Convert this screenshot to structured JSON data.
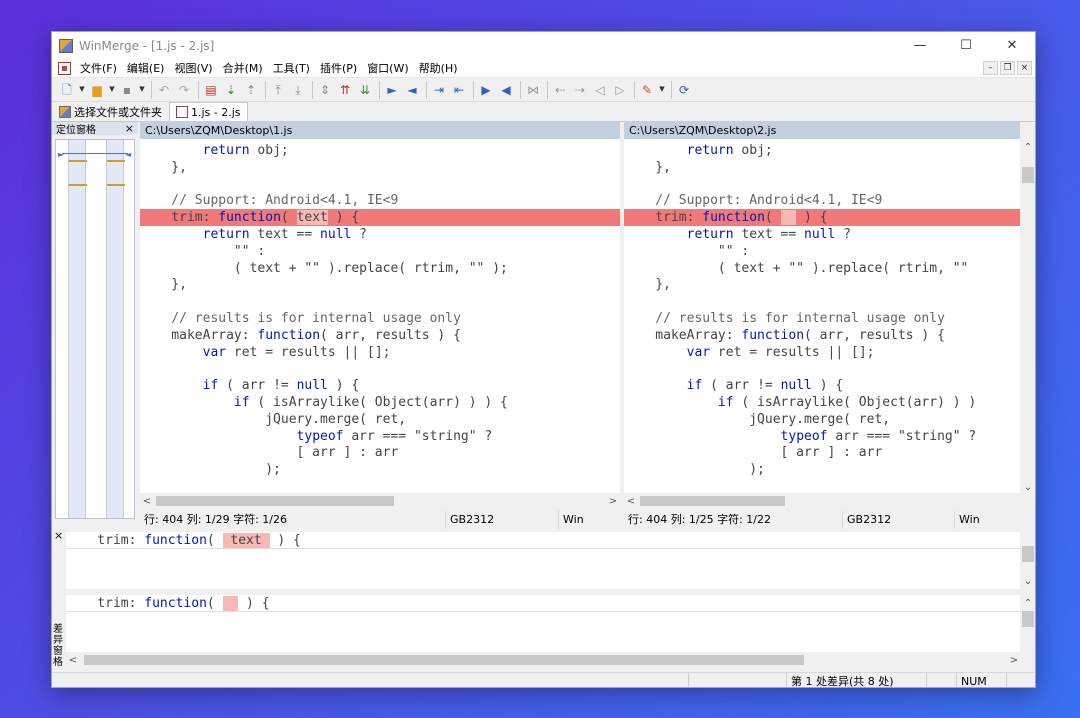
{
  "window": {
    "title": "WinMerge - [1.js - 2.js]",
    "min": "—",
    "max": "☐",
    "close": "✕"
  },
  "menu": {
    "items": [
      "文件(F)",
      "编辑(E)",
      "视图(V)",
      "合并(M)",
      "工具(T)",
      "插件(P)",
      "窗口(W)",
      "帮助(H)"
    ],
    "mdi_min": "–",
    "mdi_restore": "❐",
    "mdi_close": "×"
  },
  "tabs": {
    "open": "选择文件或文件夹",
    "compare": "1.js - 2.js"
  },
  "location_pane": {
    "title": "定位窗格",
    "close": "×",
    "left_arrow": "►",
    "right_arrow": "◄"
  },
  "left": {
    "path": "C:\\Users\\ZQM\\Desktop\\1.js",
    "status": {
      "pos": "行: 404  列: 1/29  字符: 1/26",
      "enc": "GB2312",
      "eol": "Win"
    },
    "lines": [
      [
        {
          "t": "        "
        },
        {
          "t": "return",
          "c": "kw"
        },
        {
          "t": " obj;"
        }
      ],
      [
        {
          "t": "    },"
        }
      ],
      [
        {
          "t": ""
        }
      ],
      [
        {
          "t": "    // Support: Android<4.1, IE<9",
          "c": "cm"
        }
      ],
      [
        {
          "t": "    trim: "
        },
        {
          "t": "function",
          "c": "kw"
        },
        {
          "t": "( "
        },
        {
          "t": "text",
          "c": "hl"
        },
        {
          "t": " ) {"
        }
      ],
      [
        {
          "t": "        "
        },
        {
          "t": "return",
          "c": "kw"
        },
        {
          "t": " text == "
        },
        {
          "t": "null",
          "c": "kw"
        },
        {
          "t": " ?"
        }
      ],
      [
        {
          "t": "            \"\" :"
        }
      ],
      [
        {
          "t": "            ( text + \"\" ).replace( rtrim, \"\" );"
        }
      ],
      [
        {
          "t": "    },"
        }
      ],
      [
        {
          "t": ""
        }
      ],
      [
        {
          "t": "    // results is for internal usage only",
          "c": "cm"
        }
      ],
      [
        {
          "t": "    makeArray: "
        },
        {
          "t": "function",
          "c": "kw"
        },
        {
          "t": "( arr, results ) {"
        }
      ],
      [
        {
          "t": "        "
        },
        {
          "t": "var",
          "c": "kw"
        },
        {
          "t": " ret = results || [];"
        }
      ],
      [
        {
          "t": ""
        }
      ],
      [
        {
          "t": "        "
        },
        {
          "t": "if",
          "c": "kw"
        },
        {
          "t": " ( arr != "
        },
        {
          "t": "null",
          "c": "kw"
        },
        {
          "t": " ) {"
        }
      ],
      [
        {
          "t": "            "
        },
        {
          "t": "if",
          "c": "kw"
        },
        {
          "t": " ( isArraylike( Object(arr) ) ) {"
        }
      ],
      [
        {
          "t": "                jQuery.merge( ret,"
        }
      ],
      [
        {
          "t": "                    "
        },
        {
          "t": "typeof",
          "c": "kw"
        },
        {
          "t": " arr === \"string\" ?"
        }
      ],
      [
        {
          "t": "                    [ arr ] : arr"
        }
      ],
      [
        {
          "t": "                );"
        }
      ]
    ]
  },
  "right": {
    "path": "C:\\Users\\ZQM\\Desktop\\2.js",
    "status": {
      "pos": "行: 404  列: 1/25  字符: 1/22",
      "enc": "GB2312",
      "eol": "Win"
    },
    "lines": [
      [
        {
          "t": "        "
        },
        {
          "t": "return",
          "c": "kw"
        },
        {
          "t": " obj;"
        }
      ],
      [
        {
          "t": "    },"
        }
      ],
      [
        {
          "t": ""
        }
      ],
      [
        {
          "t": "    // Support: Android<4.1, IE<9",
          "c": "cm"
        }
      ],
      [
        {
          "t": "    trim: "
        },
        {
          "t": "function",
          "c": "kw"
        },
        {
          "t": "( "
        },
        {
          "t": "  ",
          "c": "hl"
        },
        {
          "t": " ) {"
        }
      ],
      [
        {
          "t": "        "
        },
        {
          "t": "return",
          "c": "kw"
        },
        {
          "t": " text == "
        },
        {
          "t": "null",
          "c": "kw"
        },
        {
          "t": " ?"
        }
      ],
      [
        {
          "t": "            \"\" :"
        }
      ],
      [
        {
          "t": "            ( text + \"\" ).replace( rtrim, \"\""
        }
      ],
      [
        {
          "t": "    },"
        }
      ],
      [
        {
          "t": ""
        }
      ],
      [
        {
          "t": "    // results is for internal usage only",
          "c": "cm"
        }
      ],
      [
        {
          "t": "    makeArray: "
        },
        {
          "t": "function",
          "c": "kw"
        },
        {
          "t": "( arr, results ) {"
        }
      ],
      [
        {
          "t": "        "
        },
        {
          "t": "var",
          "c": "kw"
        },
        {
          "t": " ret = results || [];"
        }
      ],
      [
        {
          "t": ""
        }
      ],
      [
        {
          "t": "        "
        },
        {
          "t": "if",
          "c": "kw"
        },
        {
          "t": " ( arr != "
        },
        {
          "t": "null",
          "c": "kw"
        },
        {
          "t": " ) {"
        }
      ],
      [
        {
          "t": "            "
        },
        {
          "t": "if",
          "c": "kw"
        },
        {
          "t": " ( isArraylike( Object(arr) ) )"
        }
      ],
      [
        {
          "t": "                jQuery.merge( ret,"
        }
      ],
      [
        {
          "t": "                    "
        },
        {
          "t": "typeof",
          "c": "kw"
        },
        {
          "t": " arr === \"string\" ?"
        }
      ],
      [
        {
          "t": "                    [ arr ] : arr"
        }
      ],
      [
        {
          "t": "                );"
        }
      ]
    ]
  },
  "diff_bar": {
    "label": "差异窗格",
    "close": "×",
    "left_line": [
      {
        "t": "    trim: "
      },
      {
        "t": "function",
        "c": "kw"
      },
      {
        "t": "( "
      },
      {
        "t": " text ",
        "c": "hl"
      },
      {
        "t": " ) {"
      }
    ],
    "right_line": [
      {
        "t": "    trim: "
      },
      {
        "t": "function",
        "c": "kw"
      },
      {
        "t": "( "
      },
      {
        "t": "  ",
        "c": "hl"
      },
      {
        "t": " ) {"
      }
    ]
  },
  "status": {
    "diff_info": "第 1 处差异(共 8 处)",
    "num": "NUM"
  },
  "colors": {
    "diff_line": "#f07a78",
    "diff_word": "#f8b8b4",
    "keyword": "#0018b8",
    "path_bar": "#c2cfdf"
  },
  "icons": [
    "new-file-icon",
    "open-folder-icon",
    "save-icon",
    "undo-icon",
    "redo-icon",
    "merge-icon",
    "next-diff-icon",
    "prev-diff-icon",
    "first-diff-icon",
    "last-diff-icon",
    "copy-left-icon",
    "copy-right-icon",
    "options-icon",
    "refresh-icon"
  ]
}
